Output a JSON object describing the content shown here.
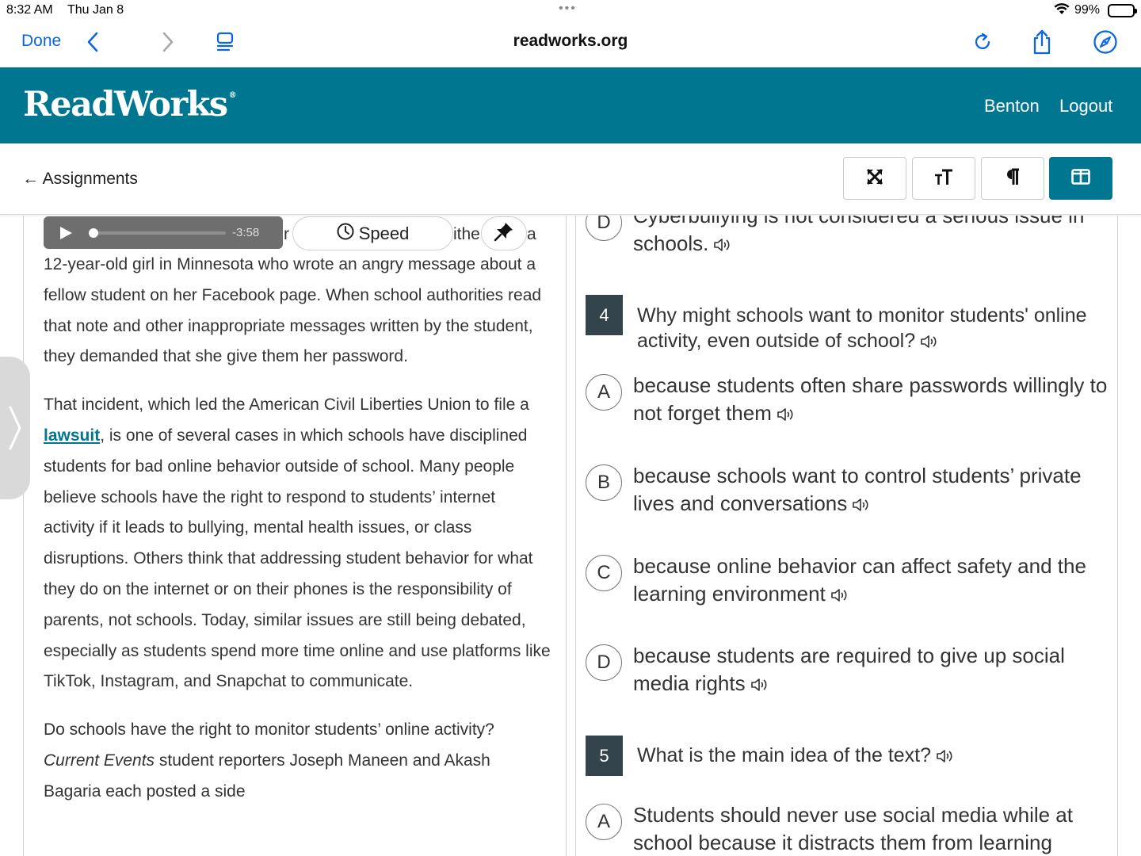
{
  "status": {
    "time": "8:32 AM",
    "date": "Thu Jan 8",
    "battery": "99%"
  },
  "browser": {
    "done": "Done",
    "url": "readworks.org"
  },
  "header": {
    "logo": "ReadWorks",
    "user": "Benton",
    "logout": "Logout"
  },
  "subbar": {
    "back": "← Assignments"
  },
  "player": {
    "time": "-3:58",
    "speed": "Speed"
  },
  "article": {
    "partial_top_1": "r",
    "partial_top_2": "ithe",
    "partial_top_3": "a",
    "p1": "12-year-old girl in Minnesota who wrote an angry message about a fellow student on her Facebook page. When school authorities read that note and other inappropriate messages written by the student, they demanded that she give them her password.",
    "p2_before": "That incident, which led the American Civil Liberties Union to file a ",
    "p2_link": "lawsuit",
    "p2_after": ", is one of several cases in which schools have disciplined students for bad online behavior outside of school. Many people believe schools have the right to respond to students’ internet activity if it leads to bullying, mental health issues, or class disruptions. Others think that addressing student behavior for what they do on the internet or on their phones is the responsibility of parents, not schools. Today, similar issues are still being debated, especially as students spend more time online and use platforms like TikTok, Instagram, and Snapchat to communicate.",
    "p3_before": "Do schools have the right to monitor students’ online activity? ",
    "p3_italic": "Current Events",
    "p3_after": " student reporters Joseph Maneen and Akash Bagaria each posted a side"
  },
  "questions": {
    "prev_option": {
      "letter": "D",
      "text": "Cyberbullying is not considered a serious issue in schools."
    },
    "q4": {
      "number": "4",
      "text": "Why might schools want to monitor students' online activity, even outside of school?",
      "options": [
        {
          "letter": "A",
          "text": "because students often share passwords willingly to not forget them"
        },
        {
          "letter": "B",
          "text": "because schools want to control students’ private lives and conversations"
        },
        {
          "letter": "C",
          "text": "because online behavior can affect safety and the learning environment"
        },
        {
          "letter": "D",
          "text": "because students are required to give up social media rights"
        }
      ]
    },
    "q5": {
      "number": "5",
      "text": "What is the main idea of the text?",
      "options": [
        {
          "letter": "A",
          "text": "Students should never use social media while at school because it distracts them from learning"
        }
      ]
    }
  },
  "colors": {
    "brand": "#007691",
    "link": "#0a66e4",
    "qnum": "#34444c"
  },
  "icons": [
    "back-chevron-icon",
    "forward-chevron-icon",
    "reader-icon",
    "reload-icon",
    "share-icon",
    "compass-icon",
    "expand-icon",
    "text-size-icon",
    "paragraph-icon",
    "split-view-icon",
    "play-icon",
    "clock-icon",
    "pin-icon",
    "speaker-icon",
    "side-chevron-icon",
    "wifi-icon"
  ]
}
